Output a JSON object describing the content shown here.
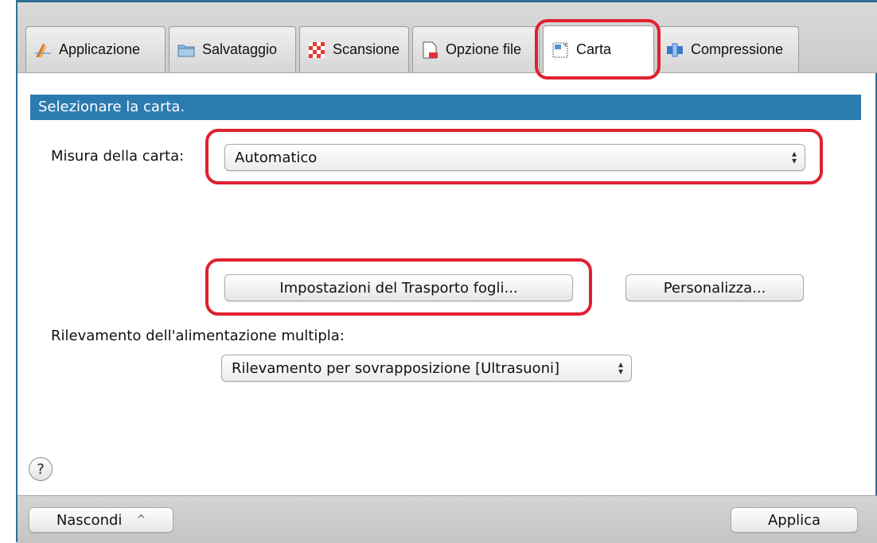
{
  "tabs": [
    {
      "label": "Applicazione",
      "icon": "application-pencil-icon",
      "active": false
    },
    {
      "label": "Salvataggio",
      "icon": "folder-icon",
      "active": false
    },
    {
      "label": "Scansione",
      "icon": "scan-checker-icon",
      "active": false
    },
    {
      "label": "Opzione file",
      "icon": "file-options-icon",
      "active": false
    },
    {
      "label": "Carta",
      "icon": "paper-icon",
      "active": true
    },
    {
      "label": "Compressione",
      "icon": "compression-icon",
      "active": false
    }
  ],
  "section": {
    "title": "Selezionare la carta."
  },
  "paper_size": {
    "label": "Misura della carta:",
    "value": "Automatico"
  },
  "buttons": {
    "carrier_settings": "Impostazioni del Trasporto fogli...",
    "customize": "Personalizza..."
  },
  "multifeed": {
    "label": "Rilevamento dell'alimentazione multipla:",
    "value": "Rilevamento per sovrapposizione [Ultrasuoni]"
  },
  "help": {
    "symbol": "?"
  },
  "footer": {
    "hide_label": "Nascondi",
    "hide_chevron": "^",
    "apply_label": "Applica"
  },
  "colors": {
    "accent_bar": "#2b7bb0",
    "highlight": "#e02030",
    "frame": "#2f6f97"
  }
}
